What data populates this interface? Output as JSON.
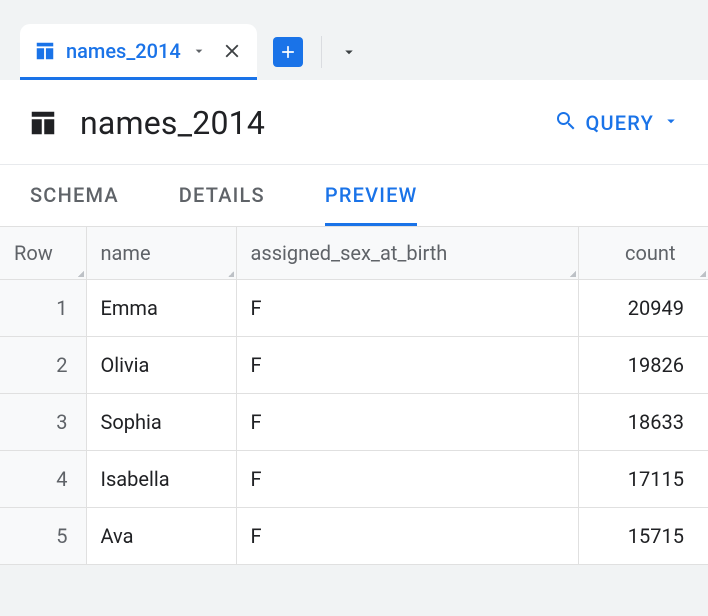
{
  "tab": {
    "label": "names_2014"
  },
  "header": {
    "title": "names_2014",
    "query_label": "QUERY"
  },
  "subtabs": [
    {
      "label": "SCHEMA"
    },
    {
      "label": "DETAILS"
    },
    {
      "label": "PREVIEW"
    }
  ],
  "active_subtab_index": 2,
  "table": {
    "columns": [
      "Row",
      "name",
      "assigned_sex_at_birth",
      "count"
    ],
    "rows": [
      {
        "row": "1",
        "name": "Emma",
        "assigned_sex_at_birth": "F",
        "count": "20949"
      },
      {
        "row": "2",
        "name": "Olivia",
        "assigned_sex_at_birth": "F",
        "count": "19826"
      },
      {
        "row": "3",
        "name": "Sophia",
        "assigned_sex_at_birth": "F",
        "count": "18633"
      },
      {
        "row": "4",
        "name": "Isabella",
        "assigned_sex_at_birth": "F",
        "count": "17115"
      },
      {
        "row": "5",
        "name": "Ava",
        "assigned_sex_at_birth": "F",
        "count": "15715"
      }
    ]
  }
}
